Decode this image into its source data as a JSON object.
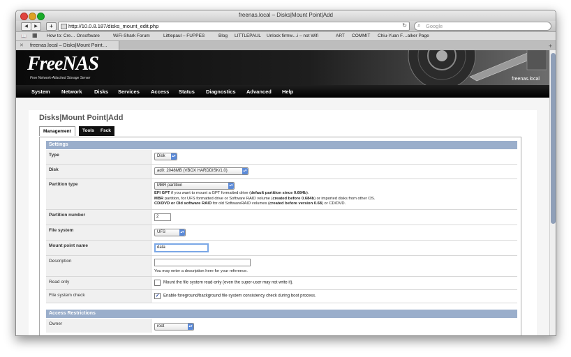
{
  "window": {
    "title": "freenas.local – Disks|Mount Point|Add",
    "url": "http://10.0.8.187/disks_mount_edit.php",
    "search_placeholder": "Google",
    "bookmarks": [
      "How to: Cre… Onsoftware",
      "WiFi-Shark Forum",
      "Littlepaul – FUPPES",
      "Blog",
      "LITTLEPAUL",
      "Unlock firmw…i – not Wifi",
      "ART",
      "COMMIT",
      "Chiu-Yuan F…alker Page"
    ],
    "tab_label": "freenas.local – Disks|Mount Point…"
  },
  "header": {
    "logo": "FreeNAS",
    "tagline": "Free Network-Attached Storage Server",
    "hostname": "freenas.local"
  },
  "menu": [
    "System",
    "Network",
    "Disks",
    "Services",
    "Access",
    "Status",
    "Diagnostics",
    "Advanced",
    "Help"
  ],
  "page": {
    "title": "Disks|Mount Point|Add",
    "tabs": [
      "Management",
      "Tools",
      "Fsck"
    ]
  },
  "sections": {
    "settings": "Settings",
    "access": "Access Restrictions"
  },
  "fields": {
    "type": {
      "label": "Type",
      "value": "Disk"
    },
    "disk": {
      "label": "Disk",
      "value": "ad0: 2048MB (VBOX HARDDISK/1.0)"
    },
    "partition_type": {
      "label": "Partition type",
      "value": "MBR partition",
      "help1_bold": "EFI GPT",
      "help1_text": " if you want to mount a GPT formatted drive (",
      "help1_bold2": "default partition since 0.684b",
      "help1_end": ").",
      "help2_bold": "MBR",
      "help2_text": " partition, for UFS formatted drive or Software RAID volume (",
      "help2_bold2": "created before 0.684b",
      "help2_end": ") or imported disks from other OS.",
      "help3_bold": "CD/DVD or Old software RAID",
      "help3_text": " for old SoftwareRAID volumes (",
      "help3_bold2": "created before version 0.68",
      "help3_end": ") or CD/DVD."
    },
    "partition_number": {
      "label": "Partition number",
      "value": "2"
    },
    "file_system": {
      "label": "File system",
      "value": "UFS"
    },
    "mount_point_name": {
      "label": "Mount point name",
      "value": "data"
    },
    "description": {
      "label": "Description",
      "value": "",
      "help": "You may enter a description here for your reference."
    },
    "read_only": {
      "label": "Read only",
      "checked": false,
      "text": "Mount the file system read-only (even the super-user may not write it)."
    },
    "fs_check": {
      "label": "File system check",
      "checked": true,
      "text": "Enable foreground/background file system consistency check during boot process."
    },
    "owner": {
      "label": "Owner",
      "value": "root"
    }
  }
}
